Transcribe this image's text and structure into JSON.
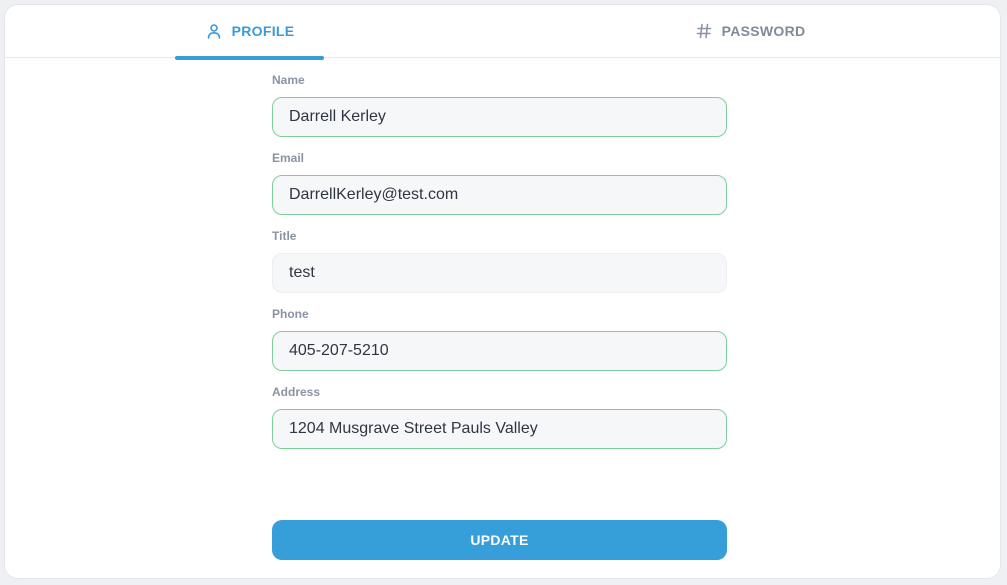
{
  "tabs": [
    {
      "label": "PROFILE",
      "icon": "user-icon",
      "active": true
    },
    {
      "label": "PASSWORD",
      "icon": "hash-icon",
      "active": false
    }
  ],
  "form": {
    "name": {
      "label": "Name",
      "value": "Darrell Kerley"
    },
    "email": {
      "label": "Email",
      "value": "DarrellKerley@test.com"
    },
    "title": {
      "label": "Title",
      "value": "test"
    },
    "phone": {
      "label": "Phone",
      "value": "405-207-5210"
    },
    "address": {
      "label": "Address",
      "value": "1204 Musgrave Street Pauls Valley"
    }
  },
  "update_label": "UPDATE",
  "colors": {
    "accent": "#369ed9",
    "valid_border": "#7fcf9c",
    "label": "#8a93a3",
    "inactive_tab": "#808a99"
  }
}
